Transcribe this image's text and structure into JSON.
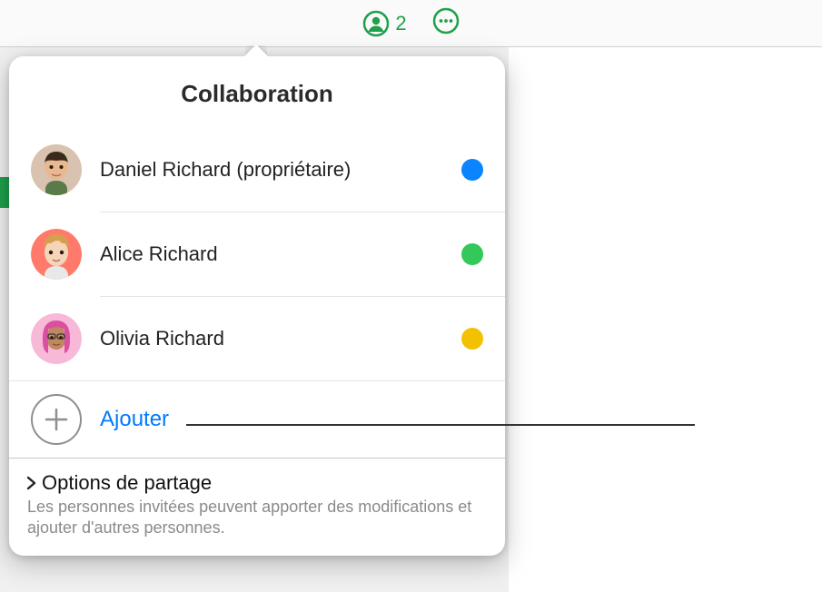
{
  "toolbar": {
    "collab_count": "2"
  },
  "popover": {
    "title": "Collaboration",
    "collaborators": [
      {
        "name": "Daniel Richard (propriétaire)",
        "dot_color": "#0a84ff",
        "avatar_bg": "#e9d4c5"
      },
      {
        "name": "Alice Richard",
        "dot_color": "#34c759",
        "avatar_bg": "#ff6a5b"
      },
      {
        "name": "Olivia Richard",
        "dot_color": "#f2c200",
        "avatar_bg": "#f8a0c8"
      }
    ],
    "add_label": "Ajouter",
    "share": {
      "title": "Options de partage",
      "desc": "Les personnes invitées peuvent apporter des modifications et ajouter d'autres personnes."
    }
  },
  "colors": {
    "accent_green": "#1fa04a",
    "link_blue": "#007aff"
  }
}
